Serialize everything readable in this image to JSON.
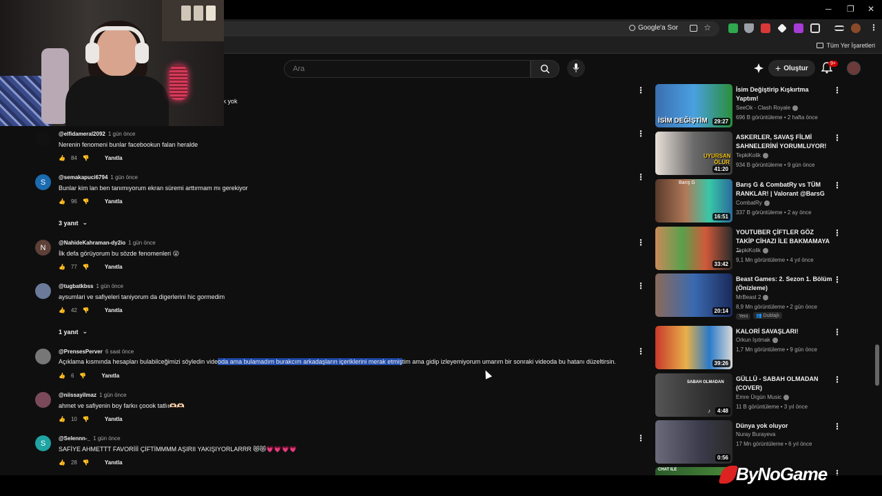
{
  "browser": {
    "google_sor": "Google'a Sor",
    "bookmarks_all": "Tüm Yer İşaretleri",
    "window_controls": [
      "─",
      "❐",
      "✕"
    ]
  },
  "header": {
    "search_placeholder": "Ara",
    "create_label": "Oluştur",
    "notif_badge": "9+"
  },
  "comments": [
    {
      "text_fragment": "dık yok"
    },
    {
      "handle": "@elfidameral2092",
      "time": "1 gün önce",
      "text": "Nerenin fenomeni bunlar facebookun falan heralde",
      "likes": "84",
      "reply": "Yanıtla"
    },
    {
      "handle": "@semakapuci6794",
      "time": "1 gün önce",
      "text": "Bunlar kim lan ben tanımıyorum ekran süremi arttırmam mı gerekiyor",
      "likes": "96",
      "reply": "Yanıtla",
      "avatar_letter": "S",
      "replies": "3 yanıt"
    },
    {
      "handle": "@NahideKahraman-dy2io",
      "time": "1 gün önce",
      "text": "İlk defa görüyorum bu sözde fenomenleri 😮",
      "likes": "77",
      "reply": "Yanıtla",
      "avatar_letter": "N"
    },
    {
      "handle": "@tugbatkbss",
      "time": "1 gün önce",
      "text": "aysumlari ve safiyeleri taniyorum da digerlerini hic gormedim",
      "likes": "42",
      "reply": "Yanıtla",
      "replies": "1 yanıt"
    },
    {
      "handle": "@PrensesPerver",
      "time": "6 saat önce",
      "text_before": "Açıklama kısmında hesapları bulabilceğimizi söyledin vide",
      "text_highlight": "oda ama bulamadım burakcım arkadaşların içeriklerini merak etmiş",
      "text_after": "tim ama gidip izleyemiyorum umarım bir sonraki videoda bu hatanı düzeltirsin.",
      "likes": "6",
      "reply": "Yanıtla"
    },
    {
      "handle": "@niissayilmaz",
      "time": "1 gün önce",
      "text": "ahmet ve safiyenin boy farkıı çoook tatlıı🫶🏻🫶🏻",
      "likes": "10",
      "reply": "Yanıtla"
    },
    {
      "handle": "@Selennn-_",
      "time": "1 gün önce",
      "text": "SAFİYE AHMETTT FAVORİİİ ÇİFTİMMMM AŞIRII YAKIŞIYORLARRR 😻😻💗💗💗💗",
      "likes": "28",
      "reply": "Yanıtla",
      "avatar_letter": "S"
    }
  ],
  "recommendations": [
    {
      "title": "İsim Değiştirip Kışkırtma Yaptım!",
      "channel": "SeeOk - Clash Royale",
      "meta": "696 B görüntüleme • 2 hafta önce",
      "duration": "29:27",
      "thumb_text": "İSİM DEĞİŞTİM"
    },
    {
      "title": "ASKERLER, SAVAŞ FİLMİ SAHNELERİNİ YORUMLUYOR!",
      "channel": "TepkiKolik",
      "meta": "934 B görüntüleme • 9 gün önce",
      "duration": "41:20",
      "thumb_text": "UYURSAN ÖLÜR"
    },
    {
      "title": "Barış G & CombatRy vs TÜM RANKLAR! | Valorant @BarsG",
      "channel": "CombatRy",
      "meta": "337 B görüntüleme • 2 ay önce",
      "duration": "16:51",
      "thumb_text": "Barış G"
    },
    {
      "title": "YOUTUBER ÇİFTLER GÖZ TAKİP CİHAZI İLE BAKMAMAYA ...",
      "channel": "TepkiKolik",
      "meta": "9,1 Mn görüntüleme • 4 yıl önce",
      "duration": "33:42"
    },
    {
      "title": "Beast Games: 2. Sezon 1. Bölüm (Önizleme)",
      "channel": "MrBeast 2",
      "meta": "8,9 Mn görüntüleme • 2 gün önce",
      "duration": "20:14",
      "tag_new": "Yeni",
      "tag_dub": "Dublajlı"
    },
    {
      "title": "KALORİ SAVAŞLARI!",
      "channel": "Orkun Işıtmak",
      "meta": "1,7 Mn görüntüleme • 9 gün önce",
      "duration": "39:26"
    },
    {
      "title": "GÜLLÜ - SABAH OLMADAN (COVER)",
      "channel": "Emre Ürgün Music",
      "meta": "11 B görüntüleme • 3 yıl önce",
      "duration": "4:48",
      "thumb_text": "SABAH OLMADAN"
    },
    {
      "title": "Dünya yok oluyor",
      "channel": "Nuray Burayeva",
      "meta": "17 Mn görüntüleme • 6 yıl önce",
      "duration": "0:56"
    },
    {
      "title": "",
      "thumb_text": "CHAT İLE"
    }
  ],
  "watermark": "ByNoGame",
  "colors": {
    "highlight": "#1f4aa8",
    "background": "#0f0f0f",
    "badge": "#cc0000"
  }
}
